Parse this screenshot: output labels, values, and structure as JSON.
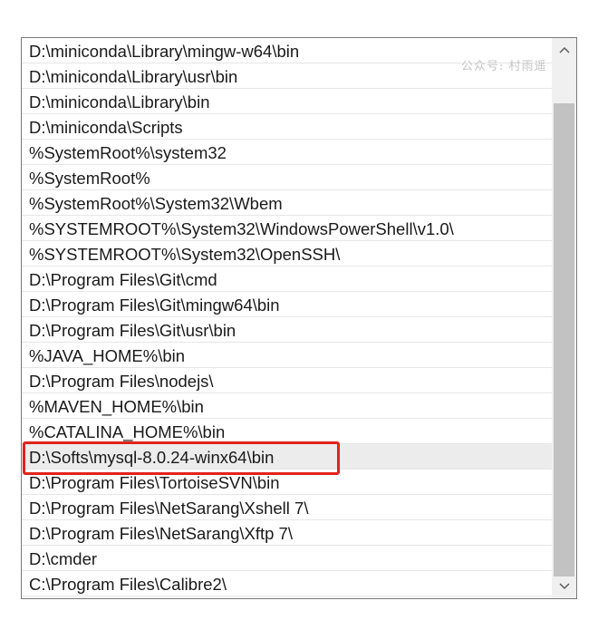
{
  "watermark": "公众号: 村雨遥",
  "paths": [
    "D:\\miniconda\\Library\\mingw-w64\\bin",
    "D:\\miniconda\\Library\\usr\\bin",
    "D:\\miniconda\\Library\\bin",
    "D:\\miniconda\\Scripts",
    "%SystemRoot%\\system32",
    "%SystemRoot%",
    "%SystemRoot%\\System32\\Wbem",
    "%SYSTEMROOT%\\System32\\WindowsPowerShell\\v1.0\\",
    "%SYSTEMROOT%\\System32\\OpenSSH\\",
    "D:\\Program Files\\Git\\cmd",
    "D:\\Program Files\\Git\\mingw64\\bin",
    "D:\\Program Files\\Git\\usr\\bin",
    "%JAVA_HOME%\\bin",
    "D:\\Program Files\\nodejs\\",
    "%MAVEN_HOME%\\bin",
    "%CATALINA_HOME%\\bin",
    "D:\\Softs\\mysql-8.0.24-winx64\\bin",
    "D:\\Program Files\\TortoiseSVN\\bin",
    "D:\\Program Files\\NetSarang\\Xshell 7\\",
    "D:\\Program Files\\NetSarang\\Xftp 7\\",
    "D:\\cmder",
    "C:\\Program Files\\Calibre2\\"
  ],
  "selected_index": 16,
  "highlight_color": "#e2231a",
  "icons": {
    "scroll_up": "chevron-up-icon",
    "scroll_down": "chevron-down-icon"
  }
}
